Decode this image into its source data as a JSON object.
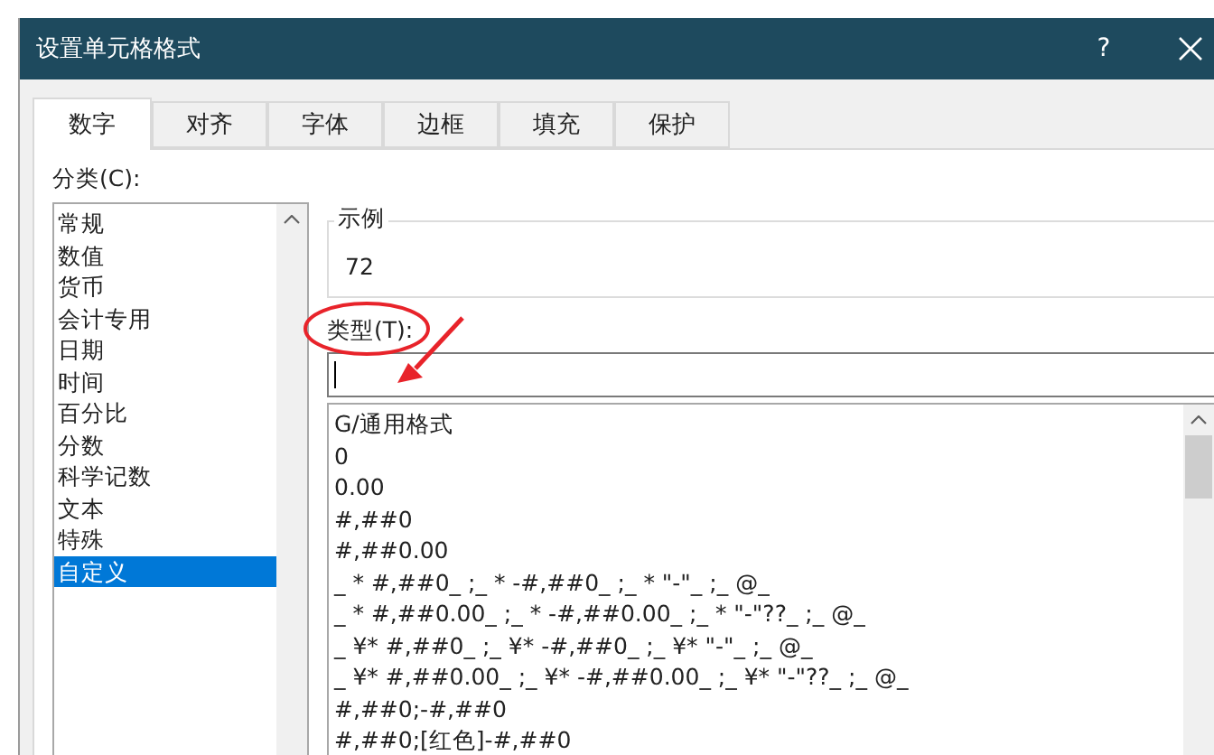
{
  "window": {
    "title": "设置单元格格式",
    "help": "?"
  },
  "tabs": [
    {
      "label": "数字",
      "selected": true
    },
    {
      "label": "对齐",
      "selected": false
    },
    {
      "label": "字体",
      "selected": false
    },
    {
      "label": "边框",
      "selected": false
    },
    {
      "label": "填充",
      "selected": false
    },
    {
      "label": "保护",
      "selected": false
    }
  ],
  "category": {
    "label": "分类(C):",
    "items": [
      {
        "label": "常规",
        "selected": false
      },
      {
        "label": "数值",
        "selected": false
      },
      {
        "label": "货币",
        "selected": false
      },
      {
        "label": "会计专用",
        "selected": false
      },
      {
        "label": "日期",
        "selected": false
      },
      {
        "label": "时间",
        "selected": false
      },
      {
        "label": "百分比",
        "selected": false
      },
      {
        "label": "分数",
        "selected": false
      },
      {
        "label": "科学记数",
        "selected": false
      },
      {
        "label": "文本",
        "selected": false
      },
      {
        "label": "特殊",
        "selected": false
      },
      {
        "label": "自定义",
        "selected": true
      }
    ]
  },
  "sample": {
    "label": "示例",
    "value": "72"
  },
  "type": {
    "label": "类型(T):",
    "formats": [
      "G/通用格式",
      "0",
      "0.00",
      "#,##0",
      "#,##0.00",
      "_ * #,##0_ ;_ * -#,##0_ ;_ * \"-\"_ ;_ @_",
      "_ * #,##0.00_ ;_ * -#,##0.00_ ;_ * \"-\"??_ ;_ @_",
      "_ ¥* #,##0_ ;_ ¥* -#,##0_ ;_ ¥* \"-\"_ ;_ @_",
      "_ ¥* #,##0.00_ ;_ ¥* -#,##0.00_ ;_ ¥* \"-\"??_ ;_ @_",
      "#,##0;-#,##0",
      "#,##0;[红色]-#,##0"
    ]
  }
}
